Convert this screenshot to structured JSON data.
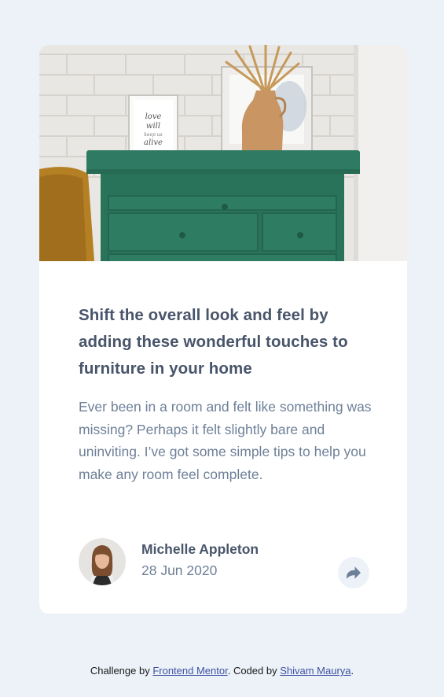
{
  "article": {
    "title": "Shift the overall look and feel by adding these wonderful touches to furniture in your home",
    "description": "Ever been in a room and felt like something was missing? Perhaps it felt slightly bare and uninviting. I’ve got some simple tips to help you make any room feel complete."
  },
  "hero_image": {
    "frame_text": [
      "love",
      "will",
      "keep us",
      "alive"
    ]
  },
  "author": {
    "name": "Michelle Appleton",
    "date": "28 Jun 2020"
  },
  "share": {
    "icon": "share-icon"
  },
  "footer": {
    "prefix": "Challenge by ",
    "link1": "Frontend Mentor",
    "middle": ". Coded by ",
    "link2": "Shivam Maurya",
    "suffix": "."
  },
  "colors": {
    "page_bg": "#ECF2F8",
    "card_bg": "#FFFFFF",
    "title": "#48556A",
    "body": "#6E8098",
    "drawer": "#2E7A62",
    "link": "#3E52A3"
  }
}
